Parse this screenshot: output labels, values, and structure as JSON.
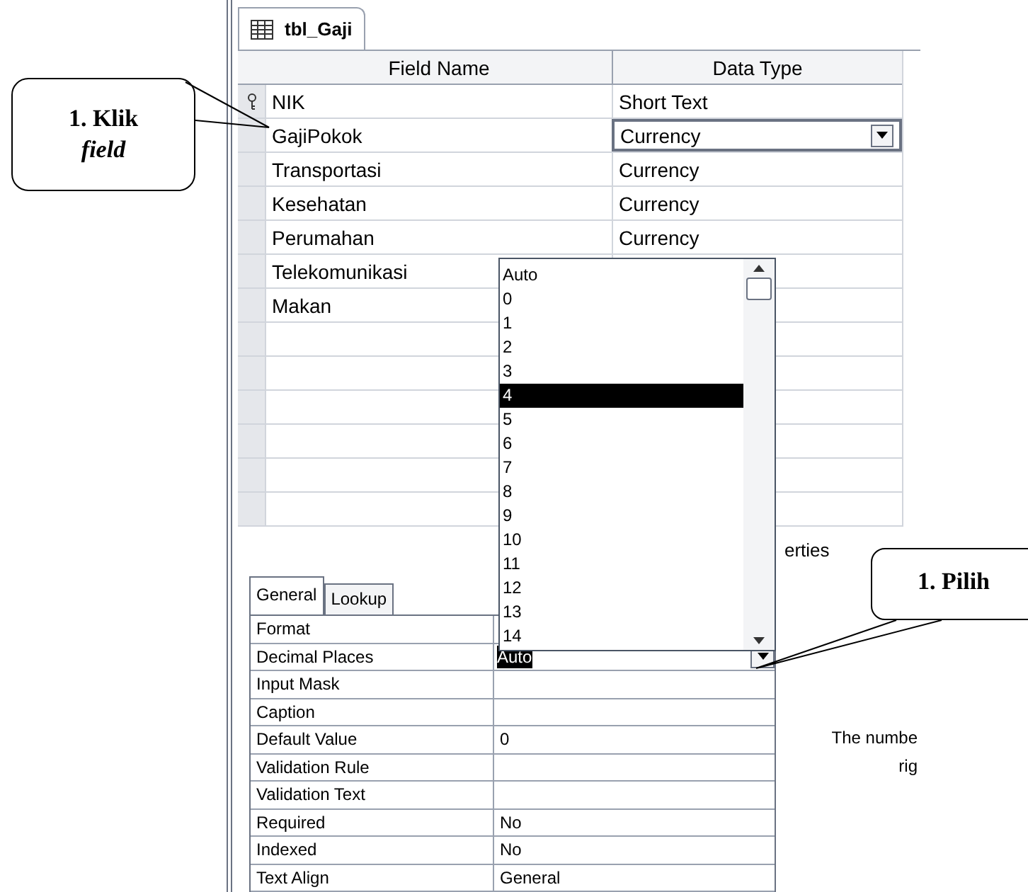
{
  "tab": {
    "label": "tbl_Gaji"
  },
  "grid": {
    "columns": [
      "Field Name",
      "Data Type"
    ],
    "rows": [
      {
        "field": "NIK",
        "type": "Short Text",
        "primary_key": true,
        "selected": false
      },
      {
        "field": "GajiPokok",
        "type": "Currency",
        "primary_key": false,
        "selected": true
      },
      {
        "field": "Transportasi",
        "type": "Currency",
        "primary_key": false,
        "selected": false
      },
      {
        "field": "Kesehatan",
        "type": "Currency",
        "primary_key": false,
        "selected": false
      },
      {
        "field": "Perumahan",
        "type": "Currency",
        "primary_key": false,
        "selected": false
      },
      {
        "field": "Telekomunikasi",
        "primary_key": false,
        "selected": false
      },
      {
        "field": "Makan",
        "primary_key": false,
        "selected": false
      }
    ]
  },
  "properties_label": "erties",
  "property_tabs": [
    {
      "label": "General",
      "selected": true
    },
    {
      "label": "Lookup",
      "selected": false
    }
  ],
  "properties": [
    {
      "label": "Format"
    },
    {
      "label": "Decimal Places",
      "value": "Auto",
      "kind": "dropdown"
    },
    {
      "label": "Input Mask"
    },
    {
      "label": "Caption"
    },
    {
      "label": "Default Value",
      "value": "0"
    },
    {
      "label": "Validation Rule"
    },
    {
      "label": "Validation Text"
    },
    {
      "label": "Required",
      "value": "No"
    },
    {
      "label": "Indexed",
      "value": "No"
    },
    {
      "label": "Text Align",
      "value": "General"
    }
  ],
  "dropdown_list": [
    {
      "label": "Auto",
      "selected": false
    },
    {
      "label": "0",
      "selected": false
    },
    {
      "label": "1",
      "selected": false
    },
    {
      "label": "2",
      "selected": false
    },
    {
      "label": "3",
      "selected": false
    },
    {
      "label": "4",
      "selected": true
    },
    {
      "label": "5",
      "selected": false
    },
    {
      "label": "6",
      "selected": false
    },
    {
      "label": "7",
      "selected": false
    },
    {
      "label": "8",
      "selected": false
    },
    {
      "label": "9",
      "selected": false
    },
    {
      "label": "10",
      "selected": false
    },
    {
      "label": "11",
      "selected": false
    },
    {
      "label": "12",
      "selected": false
    },
    {
      "label": "13",
      "selected": false
    },
    {
      "label": "14",
      "selected": false
    }
  ],
  "help_text": [
    "The numbe",
    "rig"
  ],
  "callouts": [
    {
      "title": "1. Klik",
      "subtitle": "field"
    },
    {
      "title": "1. Pilih"
    }
  ]
}
